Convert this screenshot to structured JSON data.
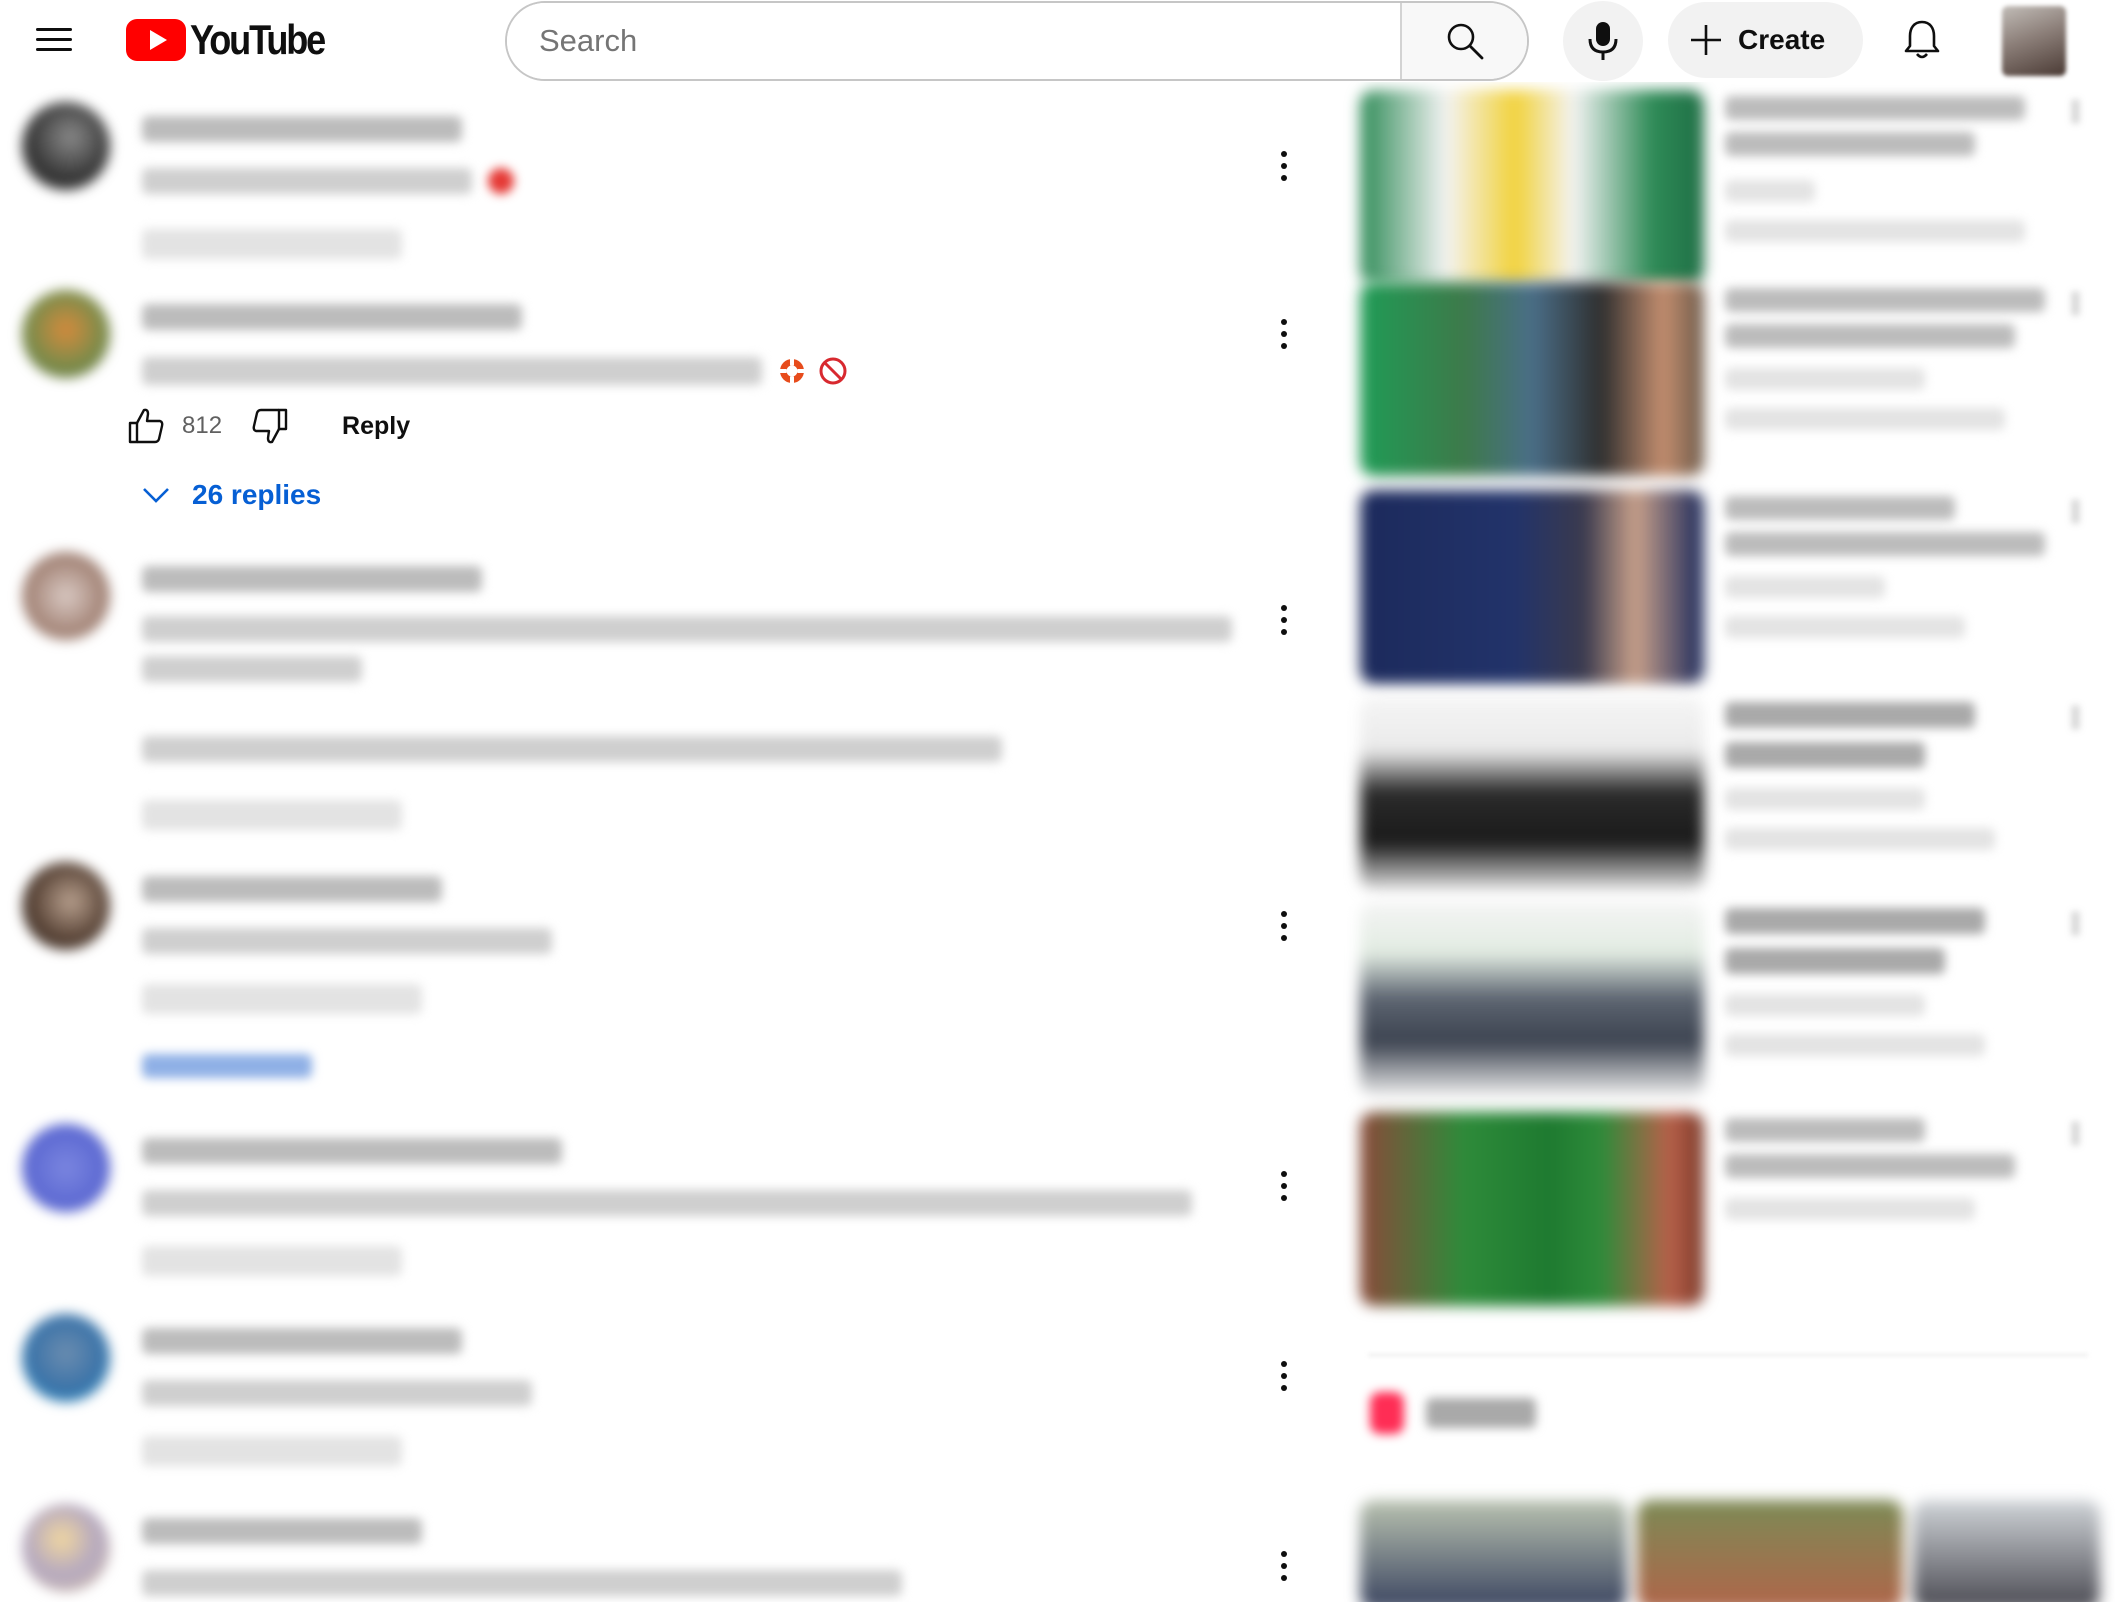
{
  "header": {
    "logo_text": "YouTube",
    "search_placeholder": "Search",
    "create_label": "Create",
    "brand_red": "#ff0000",
    "icons": [
      "menu-icon",
      "search-icon",
      "mic-icon",
      "plus-icon",
      "bell-icon"
    ]
  },
  "comments": [
    {
      "id": "c1",
      "blurred": true
    },
    {
      "id": "c2",
      "blurred": false,
      "like_count": "812",
      "reply_label": "Reply",
      "replies_label": "26 replies",
      "emojis": [
        "lifebuoy-emoji",
        "prohibited-emoji"
      ],
      "link_color": "#065fd4"
    },
    {
      "id": "c3",
      "blurred": true
    },
    {
      "id": "c4",
      "blurred": true
    },
    {
      "id": "c5",
      "blurred": true
    },
    {
      "id": "c6",
      "blurred": true
    },
    {
      "id": "c7",
      "blurred": true
    }
  ],
  "sidebar": {
    "video_count": 6,
    "shorts_section_blurred": true
  }
}
